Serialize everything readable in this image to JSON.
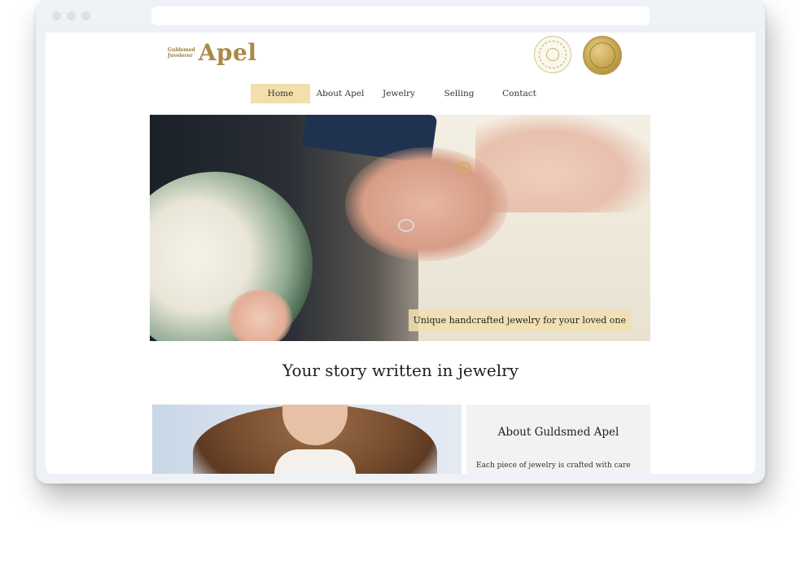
{
  "browser": {
    "url": ""
  },
  "brand": {
    "small_line_1": "Guldsmed",
    "small_line_2": "Juvelerer",
    "name": "Apel"
  },
  "badges": [
    "guild-seal-icon",
    "gold-coin-icon"
  ],
  "nav": {
    "items": [
      {
        "label": "Home",
        "active": true
      },
      {
        "label": "About Apel",
        "active": false
      },
      {
        "label": "Jewelry",
        "active": false
      },
      {
        "label": "Selling",
        "active": false
      },
      {
        "label": "Contact",
        "active": false
      }
    ]
  },
  "hero": {
    "caption": "Unique handcrafted jewelry for your loved one"
  },
  "headline": "Your story written in jewelry",
  "about": {
    "title": "About Guldsmed Apel",
    "text": "Each piece of jewelry is crafted with care"
  },
  "colors": {
    "accent": "#f2dfae",
    "brand_gold": "#a88a44",
    "panel": "#f2f2f2"
  }
}
